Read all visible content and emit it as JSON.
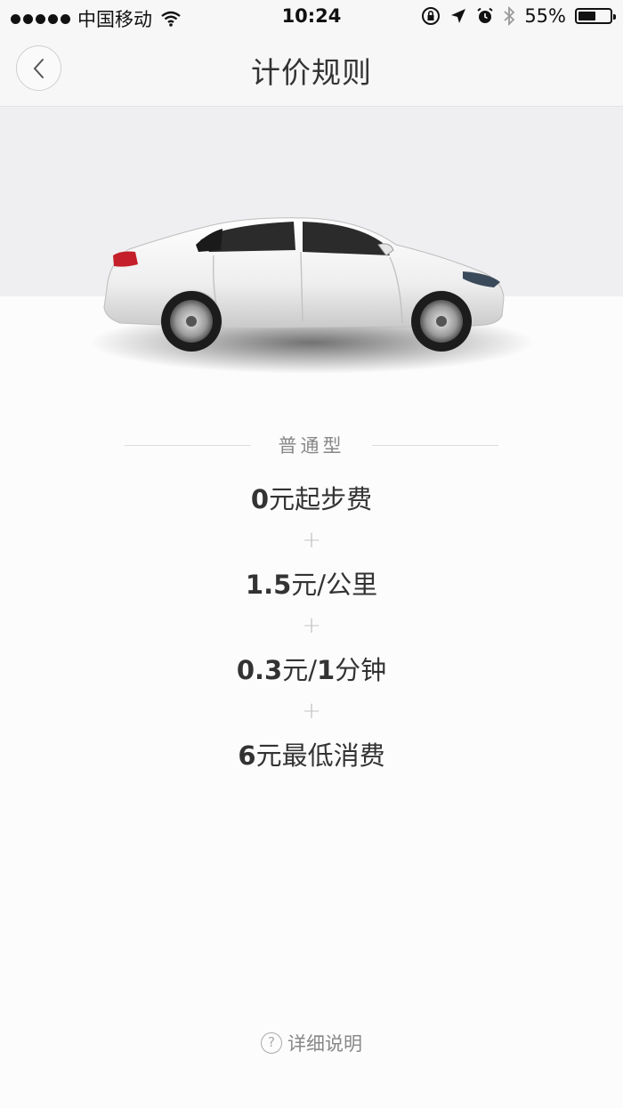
{
  "status_bar": {
    "carrier": "中国移动",
    "time": "10:24",
    "battery": "55%",
    "battery_level": 0.55
  },
  "nav": {
    "title": "计价规则",
    "back_icon": "chevron-left-icon"
  },
  "tier": {
    "label": "普通型"
  },
  "prices": [
    {
      "amount": "0",
      "text": "元起步费"
    },
    {
      "amount": "1.5",
      "text": "元/公里"
    },
    {
      "amount": "0.3",
      "text": "元/",
      "amount2": "1",
      "text2": "分钟"
    },
    {
      "amount": "6",
      "text": "元最低消费"
    }
  ],
  "plus_symbol": "+",
  "footer": {
    "detail_label": "详细说明",
    "detail_icon": "question-circle-icon",
    "icon_glyph": "?"
  },
  "colors": {
    "text": "#333333",
    "muted": "#888888",
    "hero_bg": "#efeff2"
  }
}
